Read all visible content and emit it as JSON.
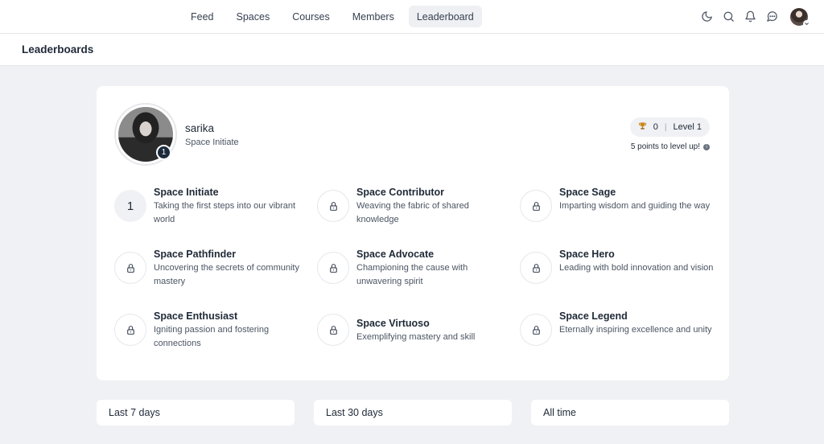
{
  "nav": {
    "items": [
      {
        "label": "Feed",
        "active": false
      },
      {
        "label": "Spaces",
        "active": false
      },
      {
        "label": "Courses",
        "active": false
      },
      {
        "label": "Members",
        "active": false
      },
      {
        "label": "Leaderboard",
        "active": true
      }
    ],
    "icons": [
      "moon-icon",
      "search-icon",
      "bell-icon",
      "chat-icon"
    ]
  },
  "header": {
    "title": "Leaderboards"
  },
  "profile": {
    "name": "sarika",
    "rank": "Space Initiate",
    "level_badge": "1",
    "points": "0",
    "level_label": "Level 1",
    "level_up_text": "5 points to level up!"
  },
  "levels": [
    {
      "title": "Space Initiate",
      "desc": "Taking the first steps into our vibrant world",
      "current": true,
      "number": "1"
    },
    {
      "title": "Space Contributor",
      "desc": "Weaving the fabric of shared knowledge",
      "current": false
    },
    {
      "title": "Space Sage",
      "desc": "Imparting wisdom and guiding the way",
      "current": false
    },
    {
      "title": "Space Pathfinder",
      "desc": "Uncovering the secrets of community mastery",
      "current": false
    },
    {
      "title": "Space Advocate",
      "desc": "Championing the cause with unwavering spirit",
      "current": false
    },
    {
      "title": "Space Hero",
      "desc": "Leading with bold innovation and vision",
      "current": false
    },
    {
      "title": "Space Enthusiast",
      "desc": "Igniting passion and fostering connections",
      "current": false
    },
    {
      "title": "Space Virtuoso",
      "desc": "Exemplifying mastery and skill",
      "current": false
    },
    {
      "title": "Space Legend",
      "desc": "Eternally inspiring excellence and unity",
      "current": false
    }
  ],
  "periods": [
    "Last 7 days",
    "Last 30 days",
    "All time"
  ],
  "colors": {
    "badge": "#1e2b3c",
    "background": "#f0f1f4",
    "trophy": "#c98a1a"
  }
}
